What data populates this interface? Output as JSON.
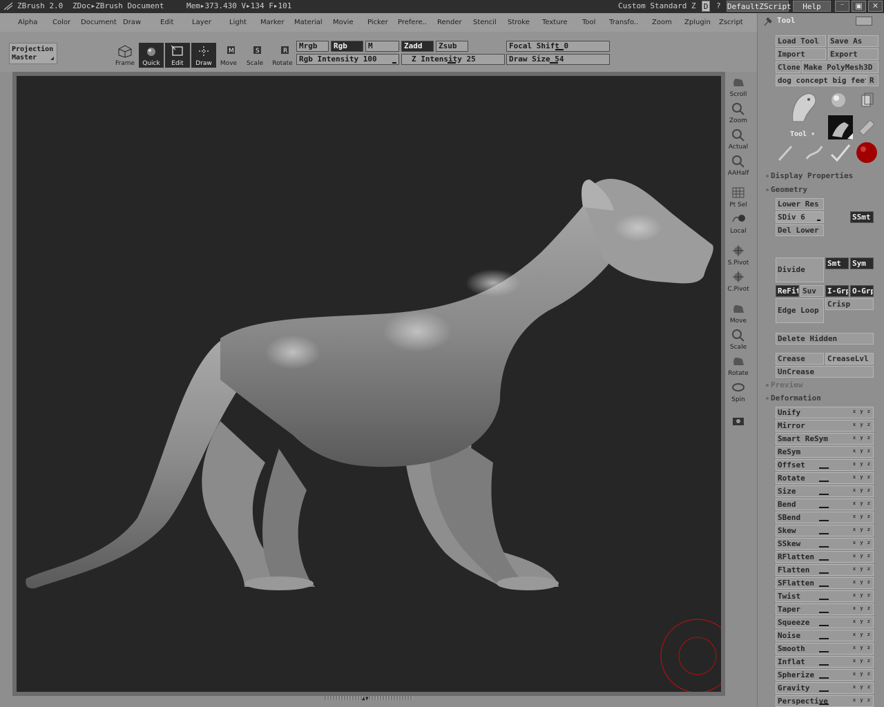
{
  "titlebar": {
    "app": "ZBrush 2.0",
    "doc": "ZDoc▸ZBrush Document",
    "mem": "Mem▸373.430  V▸134  F▸101",
    "custom": "Custom  Standard  Z",
    "d_label": "D",
    "help_q": "?",
    "script_btn": "DefaultZScript",
    "help_btn": "Help"
  },
  "menu": [
    "Alpha",
    "Color",
    "Document",
    "Draw",
    "Edit",
    "Layer",
    "Light",
    "Marker",
    "Material",
    "Movie",
    "Picker",
    "Prefere..",
    "Render",
    "Stencil",
    "Stroke",
    "Texture",
    "Tool",
    "Transfo..",
    "Zoom",
    "Zplugin",
    "Zscript"
  ],
  "toolbar": {
    "projection": "Projection\nMaster",
    "frame": "Frame",
    "quick": "Quick",
    "edit": "Edit",
    "draw": "Draw",
    "move": "Move",
    "scale": "Scale",
    "rotate": "Rotate",
    "mrgb": "Mrgb",
    "rgb": "Rgb",
    "m": "M",
    "zadd": "Zadd",
    "zsub": "Zsub",
    "rgb_intensity_label": "Rgb Intensity",
    "rgb_intensity": "100",
    "z_intensity_label": "Z Intensity",
    "z_intensity": "25",
    "focal_shift_label": "Focal Shift",
    "focal_shift": "0",
    "draw_size_label": "Draw Size",
    "draw_size": "54"
  },
  "dock": [
    "Scroll",
    "Zoom",
    "Actual",
    "AAHalf",
    "Pt Sel",
    "Local",
    "S.Pivot",
    "C.Pivot",
    "Move",
    "Scale",
    "Rotate",
    "Spin"
  ],
  "tool": {
    "header": "Tool",
    "load": "Load Tool",
    "save": "Save As",
    "import": "Import",
    "export": "Export",
    "clone": "Clone",
    "make_polymesh": "Make PolyMesh3D",
    "tool_name": "dog concept big feet",
    "r": "R",
    "tool_label": "Tool"
  },
  "geometry": {
    "display_properties": "Display Properties",
    "geometry": "Geometry",
    "lower_res": "Lower Res",
    "sdiv_label": "SDiv",
    "sdiv": "6",
    "ssmt": "SSmt",
    "del_lower": "Del Lower",
    "divide": "Divide",
    "smt": "Smt",
    "sym": "Sym",
    "refit": "ReFit",
    "suv": "Suv",
    "igrp": "I-Grp",
    "ogrp": "O-Grp",
    "crisp": "Crisp",
    "edge_loop": "Edge Loop",
    "delete_hidden": "Delete Hidden",
    "crease": "Crease",
    "creaselvl": "CreaseLvl",
    "uncrease": "UnCrease",
    "preview": "Preview",
    "deformation": "Deformation"
  },
  "deformation_items": [
    "Unify",
    "Mirror",
    "Smart ReSym",
    "ReSym",
    "Offset",
    "Rotate",
    "Size",
    "Bend",
    "SBend",
    "Skew",
    "SSkew",
    "RFlatten",
    "Flatten",
    "SFlatten",
    "Twist",
    "Taper",
    "Squeeze",
    "Noise",
    "Smooth",
    "Inflat",
    "Spherize",
    "Gravity",
    "Perspective"
  ],
  "xyz": "x y z",
  "colors": {
    "canvas": "#262626",
    "brush_cursor": "#b01010",
    "material": "#a00000"
  }
}
